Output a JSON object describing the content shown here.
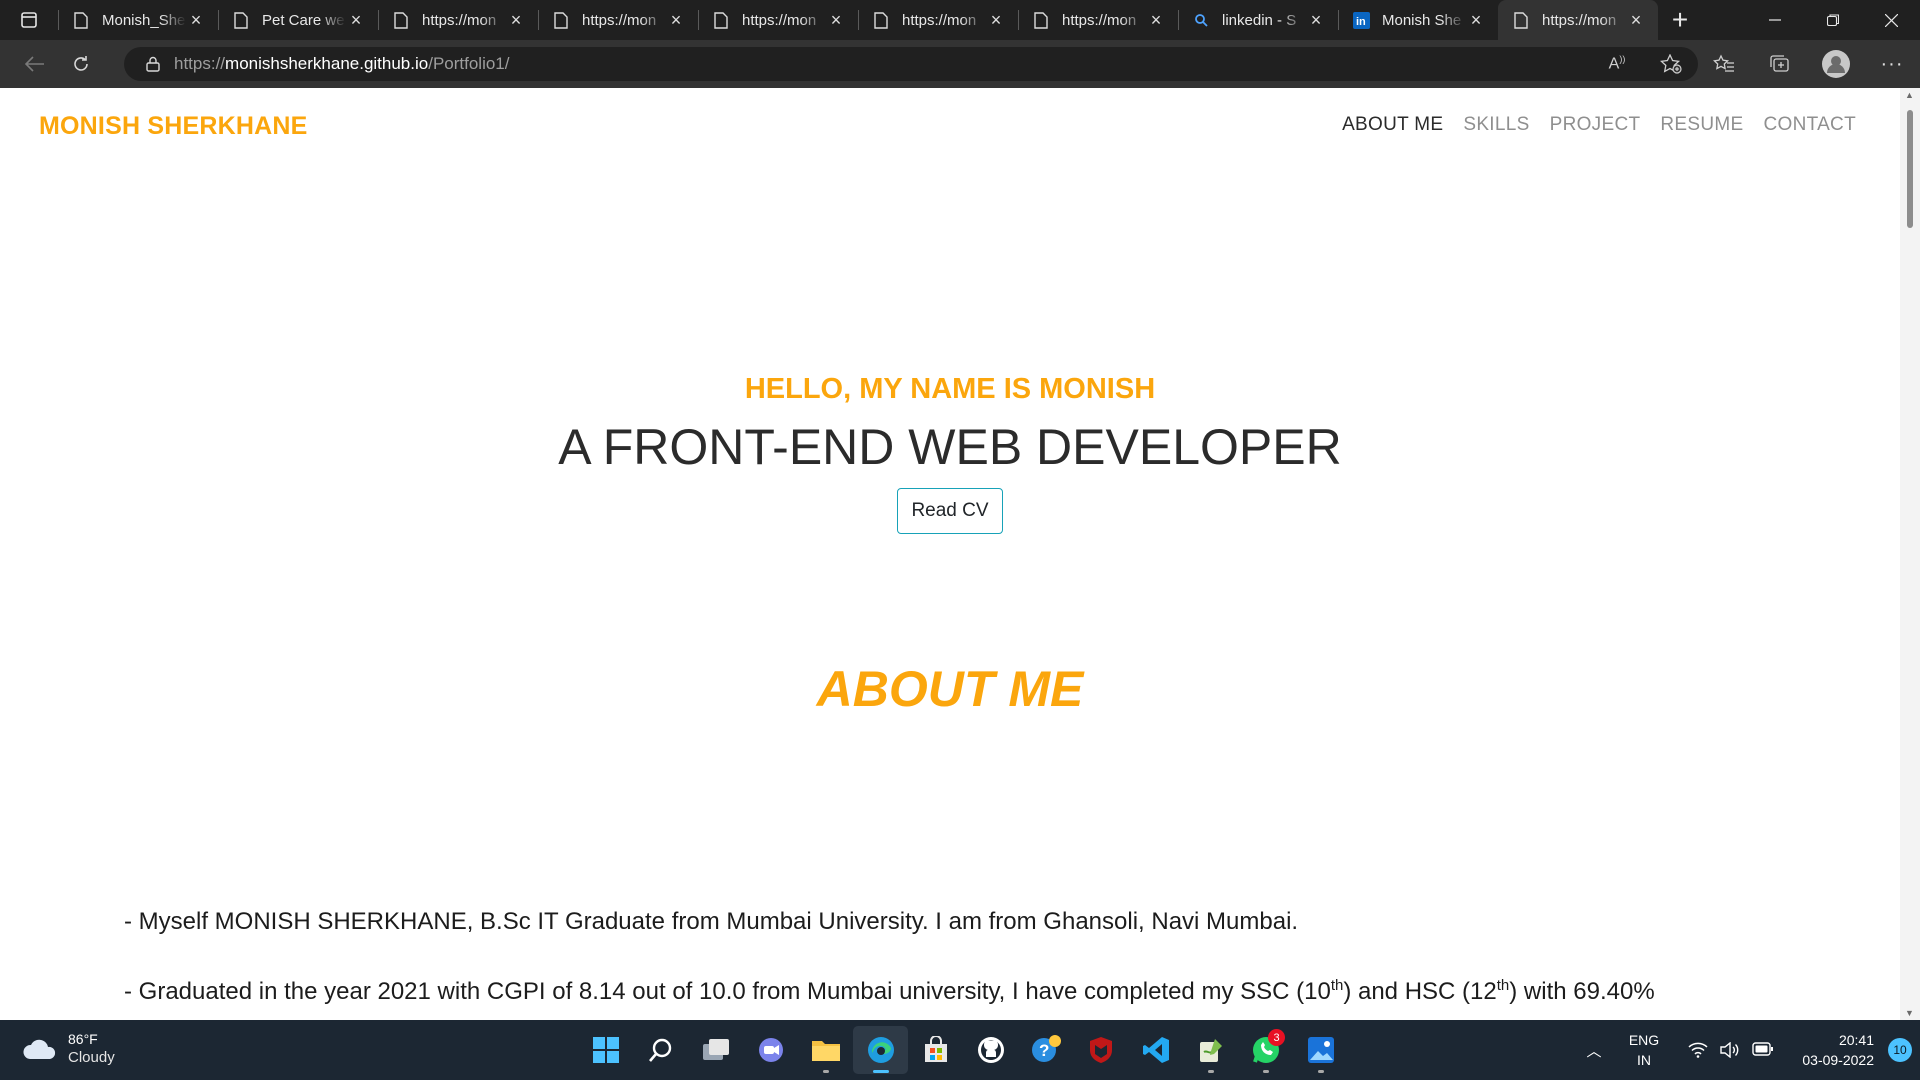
{
  "browser": {
    "tabs": [
      {
        "title": "Monish_She",
        "icon": "page-icon",
        "active": false
      },
      {
        "title": "Pet Care we",
        "icon": "page-icon",
        "active": false
      },
      {
        "title": "https://mon",
        "icon": "page-icon",
        "active": false
      },
      {
        "title": "https://mon",
        "icon": "page-icon",
        "active": false
      },
      {
        "title": "https://mon",
        "icon": "page-icon",
        "active": false
      },
      {
        "title": "https://mon",
        "icon": "page-icon",
        "active": false
      },
      {
        "title": "https://mon",
        "icon": "page-icon",
        "active": false
      },
      {
        "title": "linkedin - S",
        "icon": "search-icon",
        "active": false
      },
      {
        "title": "Monish She",
        "icon": "linkedin-icon",
        "active": false
      },
      {
        "title": "https://mon",
        "icon": "page-icon",
        "active": true
      }
    ],
    "address": {
      "scheme": "https://",
      "host": "monishsherkhane.github.io",
      "path": "/Portfolio1/"
    }
  },
  "site": {
    "brand": "MONISH SHERKHANE",
    "nav": [
      "ABOUT ME",
      "SKILLS",
      "PROJECT",
      "RESUME",
      "CONTACT"
    ],
    "hero": {
      "hello": "HELLO, MY NAME IS MONISH",
      "title": "A FRONT-END WEB DEVELOPER",
      "cta": "Read CV"
    },
    "about": {
      "heading": "ABOUT ME",
      "p1": "- Myself MONISH SHERKHANE, B.Sc IT Graduate from Mumbai University. I am from Ghansoli, Navi Mumbai.",
      "p2_a": "- Graduated in the year 2021 with CGPI of 8.14 out of 10.0 from Mumbai university, I have completed my SSC (10",
      "p2_sup1": "th",
      "p2_b": ") and HSC (12",
      "p2_sup2": "th",
      "p2_c": ") with 69.40%"
    },
    "colors": {
      "accent": "#fba60d",
      "button_border": "#17a2b8"
    }
  },
  "taskbar": {
    "weather": {
      "temp": "86°F",
      "condition": "Cloudy"
    },
    "apps": [
      "windows-start-icon",
      "search-icon",
      "task-view-icon",
      "teams-chat-icon",
      "file-explorer-icon",
      "edge-icon",
      "store-icon",
      "github-icon",
      "help-icon",
      "mcafee-icon",
      "vscode-icon",
      "notepad-icon",
      "whatsapp-icon",
      "photos-icon"
    ],
    "whatsapp_badge": "3",
    "language": {
      "line1": "ENG",
      "line2": "IN"
    },
    "time": "20:41",
    "date": "03-09-2022",
    "notifications": "10"
  }
}
